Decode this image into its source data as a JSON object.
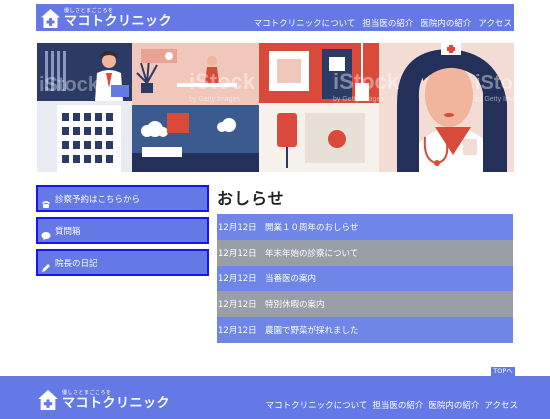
{
  "header": {
    "tagline": "優しさとまごころを",
    "clinic_name": "マコトクリニック",
    "nav": [
      {
        "label": "マコトクリニックについて"
      },
      {
        "label": "担当医の紹介"
      },
      {
        "label": "医院内の紹介"
      },
      {
        "label": "アクセス"
      }
    ]
  },
  "hero": {
    "image_alt_icon": "medical-illustration",
    "watermarks": [
      "iStock",
      "by Getty Images"
    ]
  },
  "sidebar": {
    "items": [
      {
        "label": "診察予約はこちらから",
        "icon": "phone-icon"
      },
      {
        "label": "質問箱",
        "icon": "chat-icon"
      },
      {
        "label": "院長の日記",
        "icon": "pencil-icon"
      }
    ]
  },
  "news": {
    "title": "おしらせ",
    "items": [
      {
        "date": "12月12日",
        "text": "開業１０周年のおしらせ"
      },
      {
        "date": "12月12日",
        "text": "年末年始の診察について"
      },
      {
        "date": "12月12日",
        "text": "当番医の案内"
      },
      {
        "date": "12月12日",
        "text": "特別休暇の案内"
      },
      {
        "date": "12月12日",
        "text": "農園で野菜が採れました"
      }
    ]
  },
  "top_link": "TOPへ",
  "footer": {
    "tagline": "優しさとまごころを",
    "clinic_name": "マコトクリニック",
    "nav": [
      {
        "label": "マコトクリニックについて"
      },
      {
        "label": "担当医の紹介"
      },
      {
        "label": "医院内の紹介"
      },
      {
        "label": "アクセス"
      }
    ]
  },
  "colors": {
    "primary": "#6478e6",
    "sidebar_border": "#1a14e6",
    "news_blue": "#6f86e8",
    "news_gray": "#9a9ea6"
  }
}
